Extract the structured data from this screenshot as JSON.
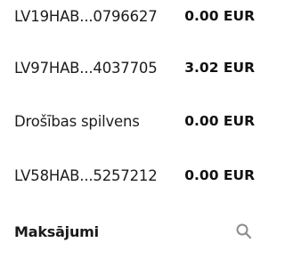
{
  "accounts": [
    {
      "name": "LV19HAB...0796627",
      "amount": "0.00 EUR"
    },
    {
      "name": "LV97HAB...4037705",
      "amount": "3.02 EUR"
    },
    {
      "name": "Drošības spilvens",
      "amount": "0.00 EUR"
    },
    {
      "name": "LV58HAB...5257212",
      "amount": "0.00 EUR"
    }
  ],
  "payments": {
    "title": "Maksājumi",
    "search_icon": "search-icon"
  },
  "colors": {
    "search_icon": "#8c8c8c",
    "text": "#1a1a1a"
  }
}
